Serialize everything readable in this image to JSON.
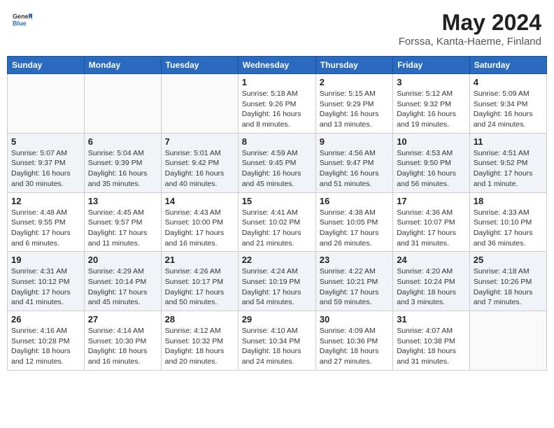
{
  "header": {
    "logo_general": "General",
    "logo_blue": "Blue",
    "main_title": "May 2024",
    "subtitle": "Forssa, Kanta-Haeme, Finland"
  },
  "columns": [
    "Sunday",
    "Monday",
    "Tuesday",
    "Wednesday",
    "Thursday",
    "Friday",
    "Saturday"
  ],
  "weeks": [
    {
      "days": [
        {
          "number": "",
          "info": ""
        },
        {
          "number": "",
          "info": ""
        },
        {
          "number": "",
          "info": ""
        },
        {
          "number": "1",
          "info": "Sunrise: 5:18 AM\nSunset: 9:26 PM\nDaylight: 16 hours and 8 minutes."
        },
        {
          "number": "2",
          "info": "Sunrise: 5:15 AM\nSunset: 9:29 PM\nDaylight: 16 hours and 13 minutes."
        },
        {
          "number": "3",
          "info": "Sunrise: 5:12 AM\nSunset: 9:32 PM\nDaylight: 16 hours and 19 minutes."
        },
        {
          "number": "4",
          "info": "Sunrise: 5:09 AM\nSunset: 9:34 PM\nDaylight: 16 hours and 24 minutes."
        }
      ]
    },
    {
      "days": [
        {
          "number": "5",
          "info": "Sunrise: 5:07 AM\nSunset: 9:37 PM\nDaylight: 16 hours and 30 minutes."
        },
        {
          "number": "6",
          "info": "Sunrise: 5:04 AM\nSunset: 9:39 PM\nDaylight: 16 hours and 35 minutes."
        },
        {
          "number": "7",
          "info": "Sunrise: 5:01 AM\nSunset: 9:42 PM\nDaylight: 16 hours and 40 minutes."
        },
        {
          "number": "8",
          "info": "Sunrise: 4:59 AM\nSunset: 9:45 PM\nDaylight: 16 hours and 45 minutes."
        },
        {
          "number": "9",
          "info": "Sunrise: 4:56 AM\nSunset: 9:47 PM\nDaylight: 16 hours and 51 minutes."
        },
        {
          "number": "10",
          "info": "Sunrise: 4:53 AM\nSunset: 9:50 PM\nDaylight: 16 hours and 56 minutes."
        },
        {
          "number": "11",
          "info": "Sunrise: 4:51 AM\nSunset: 9:52 PM\nDaylight: 17 hours and 1 minute."
        }
      ]
    },
    {
      "days": [
        {
          "number": "12",
          "info": "Sunrise: 4:48 AM\nSunset: 9:55 PM\nDaylight: 17 hours and 6 minutes."
        },
        {
          "number": "13",
          "info": "Sunrise: 4:45 AM\nSunset: 9:57 PM\nDaylight: 17 hours and 11 minutes."
        },
        {
          "number": "14",
          "info": "Sunrise: 4:43 AM\nSunset: 10:00 PM\nDaylight: 17 hours and 16 minutes."
        },
        {
          "number": "15",
          "info": "Sunrise: 4:41 AM\nSunset: 10:02 PM\nDaylight: 17 hours and 21 minutes."
        },
        {
          "number": "16",
          "info": "Sunrise: 4:38 AM\nSunset: 10:05 PM\nDaylight: 17 hours and 26 minutes."
        },
        {
          "number": "17",
          "info": "Sunrise: 4:36 AM\nSunset: 10:07 PM\nDaylight: 17 hours and 31 minutes."
        },
        {
          "number": "18",
          "info": "Sunrise: 4:33 AM\nSunset: 10:10 PM\nDaylight: 17 hours and 36 minutes."
        }
      ]
    },
    {
      "days": [
        {
          "number": "19",
          "info": "Sunrise: 4:31 AM\nSunset: 10:12 PM\nDaylight: 17 hours and 41 minutes."
        },
        {
          "number": "20",
          "info": "Sunrise: 4:29 AM\nSunset: 10:14 PM\nDaylight: 17 hours and 45 minutes."
        },
        {
          "number": "21",
          "info": "Sunrise: 4:26 AM\nSunset: 10:17 PM\nDaylight: 17 hours and 50 minutes."
        },
        {
          "number": "22",
          "info": "Sunrise: 4:24 AM\nSunset: 10:19 PM\nDaylight: 17 hours and 54 minutes."
        },
        {
          "number": "23",
          "info": "Sunrise: 4:22 AM\nSunset: 10:21 PM\nDaylight: 17 hours and 59 minutes."
        },
        {
          "number": "24",
          "info": "Sunrise: 4:20 AM\nSunset: 10:24 PM\nDaylight: 18 hours and 3 minutes."
        },
        {
          "number": "25",
          "info": "Sunrise: 4:18 AM\nSunset: 10:26 PM\nDaylight: 18 hours and 7 minutes."
        }
      ]
    },
    {
      "days": [
        {
          "number": "26",
          "info": "Sunrise: 4:16 AM\nSunset: 10:28 PM\nDaylight: 18 hours and 12 minutes."
        },
        {
          "number": "27",
          "info": "Sunrise: 4:14 AM\nSunset: 10:30 PM\nDaylight: 18 hours and 16 minutes."
        },
        {
          "number": "28",
          "info": "Sunrise: 4:12 AM\nSunset: 10:32 PM\nDaylight: 18 hours and 20 minutes."
        },
        {
          "number": "29",
          "info": "Sunrise: 4:10 AM\nSunset: 10:34 PM\nDaylight: 18 hours and 24 minutes."
        },
        {
          "number": "30",
          "info": "Sunrise: 4:09 AM\nSunset: 10:36 PM\nDaylight: 18 hours and 27 minutes."
        },
        {
          "number": "31",
          "info": "Sunrise: 4:07 AM\nSunset: 10:38 PM\nDaylight: 18 hours and 31 minutes."
        },
        {
          "number": "",
          "info": ""
        }
      ]
    }
  ]
}
